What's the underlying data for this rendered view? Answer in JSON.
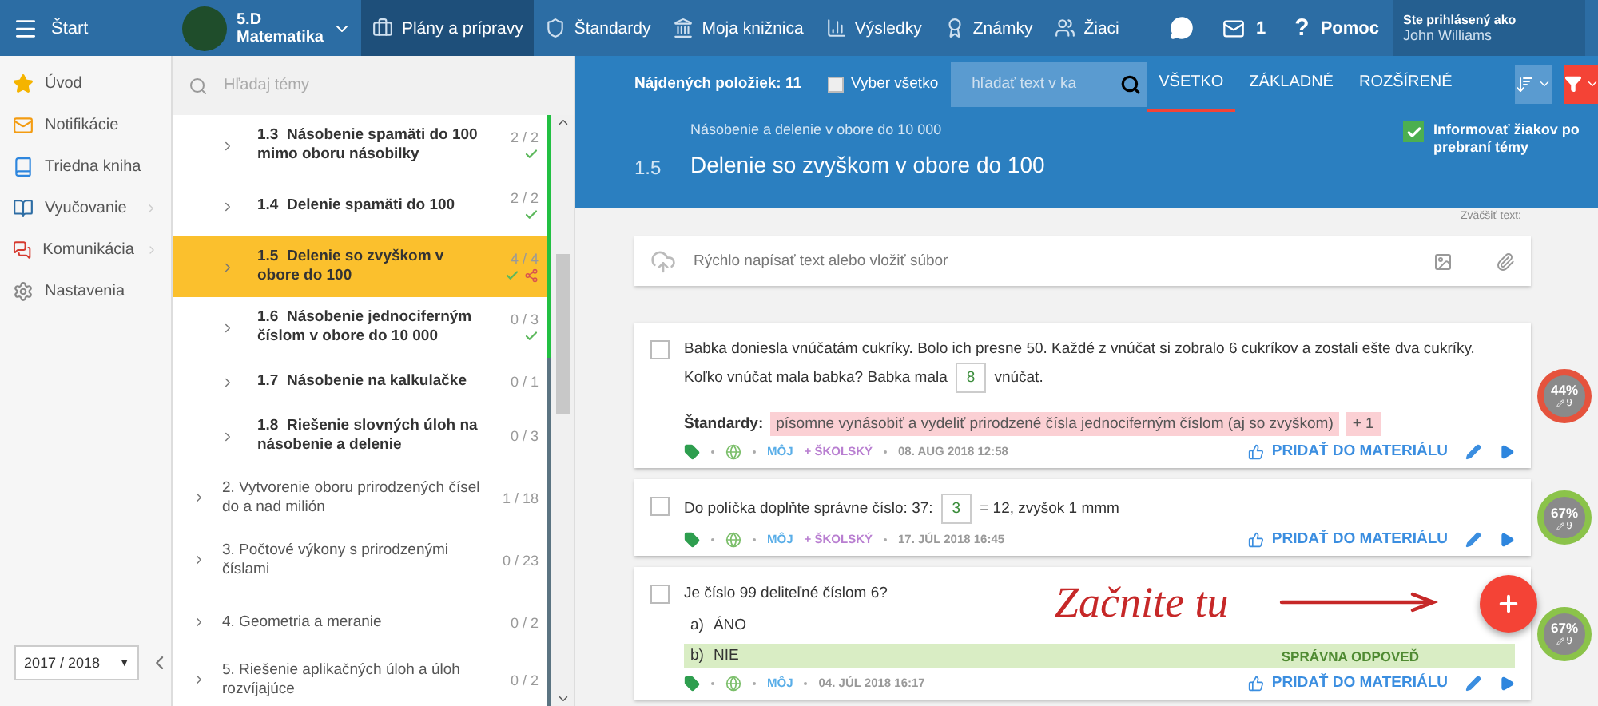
{
  "top_bar": {
    "menu_label": "Štart",
    "class_selector": {
      "class": "5.D",
      "subject": "Matematika"
    },
    "nav": [
      {
        "label": "Plány a prípravy",
        "kind": "plans",
        "selected": true
      },
      {
        "label": "Štandardy",
        "kind": "standards",
        "selected": false
      },
      {
        "label": "Moja knižnica",
        "kind": "library",
        "selected": false
      },
      {
        "label": "Výsledky",
        "kind": "results",
        "selected": false
      },
      {
        "label": "Známky",
        "kind": "grades",
        "selected": false
      },
      {
        "label": "Žiaci",
        "kind": "students",
        "selected": false
      }
    ],
    "mail_count": "1",
    "help_mark": "?",
    "help_label": "Pomoc",
    "user": {
      "caption": "Ste prihlásený ako",
      "name": "John Williams"
    }
  },
  "sidebar": {
    "items": [
      {
        "label": "Úvod",
        "kind": "home",
        "has_submenu": false
      },
      {
        "label": "Notifikácie",
        "kind": "notifications",
        "has_submenu": false
      },
      {
        "label": "Triedna kniha",
        "kind": "classbook",
        "has_submenu": false
      },
      {
        "label": "Vyučovanie",
        "kind": "teaching",
        "has_submenu": true
      },
      {
        "label": "Komunikácia",
        "kind": "communication",
        "has_submenu": true
      },
      {
        "label": "Nastavenia",
        "kind": "settings",
        "has_submenu": false
      }
    ],
    "year": "2017 / 2018",
    "year_caret": "▼"
  },
  "topics": {
    "search_placeholder": "Hľadaj témy",
    "subtopics": [
      {
        "number": "1.3",
        "title": "Násobenie spamäti do 100 mimo oboru násobilky",
        "count": "2 / 2",
        "done": true,
        "shared": false,
        "selected": false,
        "color": "#22c042"
      },
      {
        "number": "1.4",
        "title": "Delenie spamäti do 100",
        "count": "2 / 2",
        "done": true,
        "shared": false,
        "selected": false,
        "color": "#22c042"
      },
      {
        "number": "1.5",
        "title": "Delenie so zvyškom v obore do 100",
        "count": "4 / 4",
        "done": true,
        "shared": true,
        "selected": true,
        "color": "#22c042"
      },
      {
        "number": "1.6",
        "title": "Násobenie jednociferným číslom v obore do 10 000",
        "count": "0 / 3",
        "done": true,
        "shared": false,
        "selected": false,
        "color": "#22c042"
      },
      {
        "number": "1.7",
        "title": "Násobenie na kalkulačke",
        "count": "0 / 1",
        "done": false,
        "shared": false,
        "selected": false,
        "color": "#5b7482"
      },
      {
        "number": "1.8",
        "title": "Riešenie slovných úloh na násobenie a delenie",
        "count": "0 / 3",
        "done": false,
        "shared": false,
        "selected": false,
        "color": "#5b7482"
      }
    ],
    "chapters": [
      {
        "title": "2. Vytvorenie oboru prirodzených čísel do a nad milión",
        "count": "1 / 18",
        "color": "#5b7482"
      },
      {
        "title": "3. Počtové výkony s prirodzenými číslami",
        "count": "0 / 23",
        "color": "#5b7482"
      },
      {
        "title": "4. Geometria a meranie",
        "count": "0 / 2",
        "color": "#5b7482"
      },
      {
        "title": "5. Riešenie aplikačných úloh a úloh rozvíjajúce",
        "count": "0 / 2",
        "color": "#5b7482"
      }
    ]
  },
  "toolbar": {
    "found": "Nájdených položiek: 11",
    "select_all": {
      "label": "Vyber všetko",
      "checked": false
    },
    "search_placeholder": "hľadať text v ka",
    "tabs": [
      {
        "label": "VŠETKO",
        "selected": true
      },
      {
        "label": "ZÁKLADNÉ",
        "selected": false
      },
      {
        "label": "ROZŠÍRENÉ",
        "selected": false
      }
    ]
  },
  "topic_header": {
    "breadcrumb": "Násobenie a delenie v obore do 10 000",
    "number": "1.5",
    "title": "Delenie so zvyškom v obore do 100",
    "notify": {
      "label": "Informovať žiakov po prebraní témy",
      "checked": true
    }
  },
  "zoom_label": "Zväčšiť text:",
  "composer": {
    "placeholder": "Rýchlo napísať text alebo vložiť súbor"
  },
  "cards": [
    {
      "kind": "fill",
      "checked": false,
      "text_before": "Babka doniesla vnúčatám cukríky. Bolo ich presne 50. Každé z vnúčat si zobralo 6 cukríkov a zostali ešte dva cukríky. Koľko vnúčat mala babka? Babka mala",
      "answer": "8",
      "text_after": "vnúčat.",
      "standards": {
        "label": "Štandardy:",
        "tags": [
          "písomne vynásobiť a vydeliť prirodzené čísla jednociferným číslom (aj so zvyškom)",
          "+ 1"
        ]
      },
      "sources": [
        {
          "label": "MÔJ",
          "kind": "own"
        },
        {
          "label": "+ ŠKOLSKÝ",
          "kind": "school"
        }
      ],
      "date": "08. AUG 2018 12:58",
      "action": "PRIDAŤ DO MATERIÁLU",
      "score": "44%",
      "count": "9",
      "color": "#e5533d"
    },
    {
      "kind": "fill",
      "checked": false,
      "text_before": "Do políčka doplňte správne číslo: 37:",
      "answer": "3",
      "text_after": "= 12, zvyšok 1  mmm",
      "sources": [
        {
          "label": "MÔJ",
          "kind": "own"
        },
        {
          "label": "+ ŠKOLSKÝ",
          "kind": "school"
        }
      ],
      "date": "17. JÚL 2018 16:45",
      "action": "PRIDAŤ DO MATERIÁLU",
      "score": "67%",
      "count": "9",
      "color": "#8bc34a"
    },
    {
      "kind": "choice",
      "checked": false,
      "question": "Je číslo 99 deliteľné číslom 6?",
      "options": [
        {
          "letter": "a)",
          "text": "ÁNO",
          "correct": false
        },
        {
          "letter": "b)",
          "text": "NIE",
          "correct": true
        }
      ],
      "correct_label": "SPRÁVNA ODPOVEĎ",
      "sources": [
        {
          "label": "MÔJ",
          "kind": "own"
        }
      ],
      "date": "04. JÚL 2018 16:17",
      "action": "PRIDAŤ DO MATERIÁLU",
      "score": "67%",
      "count": "9",
      "color": "#8bc34a"
    }
  ],
  "callout": "Začnite tu"
}
